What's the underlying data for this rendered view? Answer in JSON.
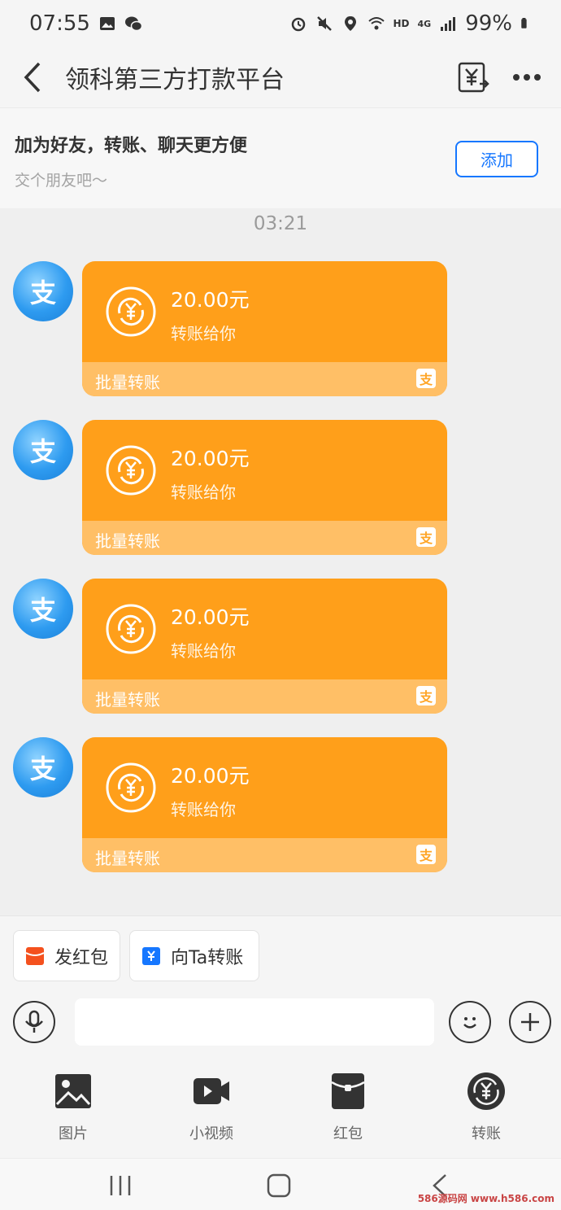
{
  "status": {
    "time": "07:55",
    "battery": "99%",
    "network": "HD",
    "signal_label": "4G"
  },
  "nav": {
    "title": "领科第三方打款平台"
  },
  "banner": {
    "title": "加为好友，转账、聊天更方便",
    "subtitle": "交个朋友吧～",
    "add_label": "添加"
  },
  "chat": {
    "time": "03:21",
    "avatar_char": "支",
    "messages": [
      {
        "amount": "20.00元",
        "subtitle": "转账给你",
        "footer": "批量转账"
      },
      {
        "amount": "20.00元",
        "subtitle": "转账给你",
        "footer": "批量转账"
      },
      {
        "amount": "20.00元",
        "subtitle": "转账给你",
        "footer": "批量转账"
      },
      {
        "amount": "20.00元",
        "subtitle": "转账给你",
        "footer": "批量转账"
      }
    ],
    "card_color": "#ff9f1a",
    "card_footer_color": "#ffbf66"
  },
  "quick_actions": {
    "red_packet": "发红包",
    "transfer": "向Ta转账"
  },
  "input": {
    "placeholder": ""
  },
  "toolbar": {
    "items": [
      {
        "label": "图片",
        "icon": "image-icon"
      },
      {
        "label": "小视频",
        "icon": "video-icon"
      },
      {
        "label": "红包",
        "icon": "red-packet-icon"
      },
      {
        "label": "转账",
        "icon": "transfer-icon"
      }
    ]
  },
  "watermark": "586源码网 www.h586.com"
}
